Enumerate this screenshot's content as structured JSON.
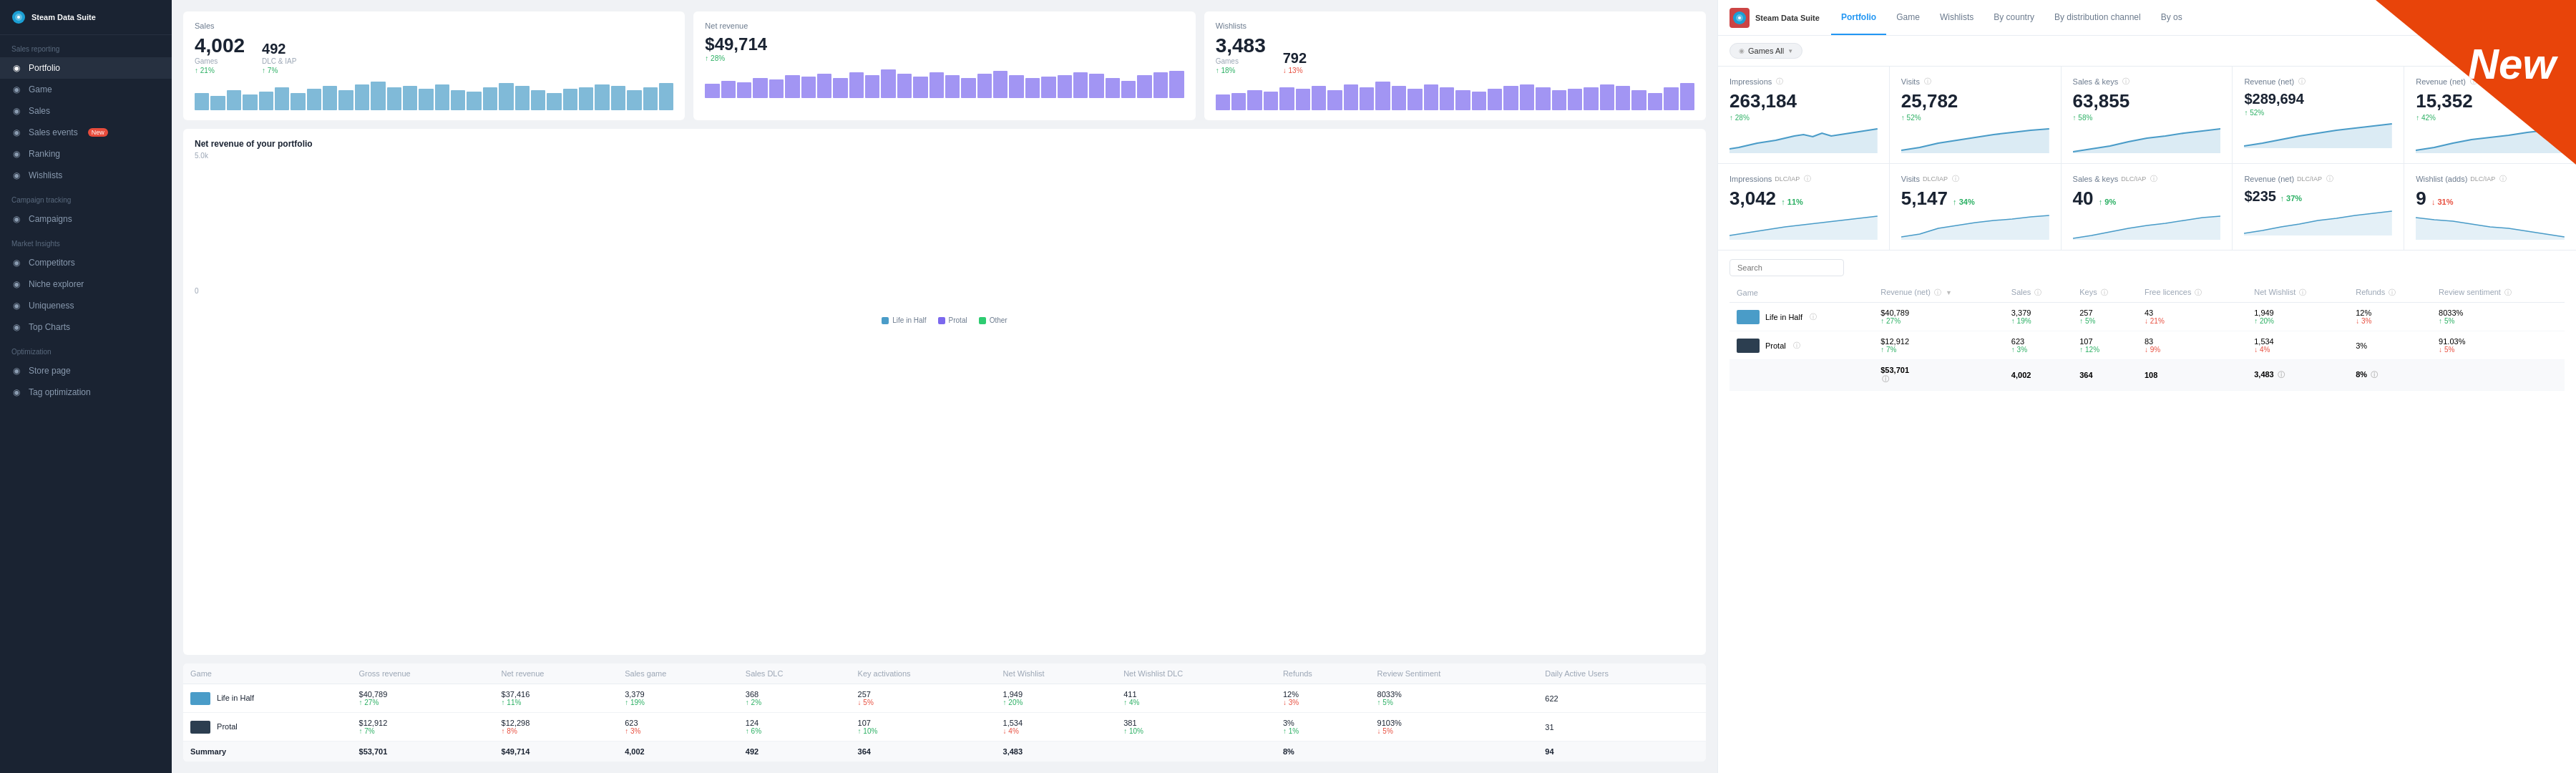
{
  "sidebar": {
    "logo": "Steam Data Suite",
    "sections": [
      {
        "label": "Sales reporting",
        "items": [
          {
            "id": "portfolio",
            "label": "Portfolio",
            "icon": "◉",
            "active": true
          },
          {
            "id": "game",
            "label": "Game",
            "icon": "◉"
          },
          {
            "id": "sales",
            "label": "Sales",
            "icon": "◉"
          },
          {
            "id": "sales-events",
            "label": "Sales events",
            "icon": "◉",
            "badge": "New"
          },
          {
            "id": "ranking",
            "label": "Ranking",
            "icon": "◉"
          },
          {
            "id": "wishlists",
            "label": "Wishlists",
            "icon": "◉"
          }
        ]
      },
      {
        "label": "Campaign tracking",
        "items": [
          {
            "id": "campaigns",
            "label": "Campaigns",
            "icon": "◉"
          }
        ]
      },
      {
        "label": "Market Insights",
        "items": [
          {
            "id": "competitors",
            "label": "Competitors",
            "icon": "◉"
          },
          {
            "id": "niche-explorer",
            "label": "Niche explorer",
            "icon": "◉"
          },
          {
            "id": "uniqueness",
            "label": "Uniqueness",
            "icon": "◉"
          },
          {
            "id": "top-charts",
            "label": "Top Charts",
            "icon": "◉"
          }
        ]
      },
      {
        "label": "Optimization",
        "items": [
          {
            "id": "store-page",
            "label": "Store page",
            "icon": "◉"
          },
          {
            "id": "tag-optimization",
            "label": "Tag optimization",
            "icon": "◉"
          }
        ]
      }
    ]
  },
  "top_cards": [
    {
      "title": "Sales",
      "metrics": [
        {
          "value": "4,002",
          "label": "Games",
          "change": "↑ 21%",
          "up": true
        },
        {
          "value": "492",
          "label": "DLC & IAP",
          "change": "↑ 7%",
          "up": true
        }
      ]
    },
    {
      "title": "Net revenue",
      "metrics": [
        {
          "value": "$49,714",
          "label": "",
          "change": "↑ 28%",
          "up": true
        }
      ]
    },
    {
      "title": "Wishlists",
      "metrics": [
        {
          "value": "3,483",
          "label": "Games",
          "change": "↑ 18%",
          "up": true
        },
        {
          "value": "792",
          "label": "",
          "change": "↓ 13%",
          "up": false
        }
      ]
    }
  ],
  "net_revenue_chart": {
    "title": "Net revenue of your portfolio",
    "y_label": "5.0k",
    "y_label_bottom": "0",
    "legend": [
      {
        "label": "Life in Half",
        "color": "#4a9cc8"
      },
      {
        "label": "Protal",
        "color": "#7b68ee"
      },
      {
        "label": "Other",
        "color": "#2ecc71"
      }
    ]
  },
  "table": {
    "columns": [
      "Game",
      "Gross revenue",
      "Net revenue",
      "Sales game",
      "Sales DLC",
      "Key activations",
      "Net Wishlist",
      "Net Wishlist DLC",
      "Refunds",
      "Review Sentiment",
      "Daily Active Users"
    ],
    "rows": [
      {
        "game": "Life in Half",
        "thumb_color": "#4a9cc8",
        "gross_revenue": "$40,789",
        "gross_change": "↑ 27%",
        "net_revenue": "$37,416",
        "net_change": "↑ 11%",
        "sales_game": "3,379",
        "sales_game_change": "↑ 19%",
        "sales_dlc": "368",
        "sales_dlc_change": "↑ 2%",
        "key_act": "257",
        "key_change": "↓ 5%",
        "net_wish": "1,949",
        "net_wish_change": "↑ 20%",
        "net_wish_dlc": "411",
        "net_wish_dlc_change": "↑ 4%",
        "refunds": "12%",
        "refunds_change": "↓ 3%",
        "sentiment": "8033%",
        "sentiment_change": "↑ 5%",
        "dau": "622"
      },
      {
        "game": "Protal",
        "thumb_color": "#2c3e50",
        "gross_revenue": "$12,912",
        "gross_change": "↑ 7%",
        "net_revenue": "$12,298",
        "net_change": "↑ 8%",
        "sales_game": "623",
        "sales_game_change": "↑ 3%",
        "sales_dlc": "124",
        "sales_dlc_change": "↑ 6%",
        "key_act": "107",
        "key_change": "↑ 10%",
        "net_wish": "1,534",
        "net_wish_change": "↓ 4%",
        "net_wish_dlc": "381",
        "net_wish_dlc_change": "↑ 10%",
        "refunds": "3%",
        "refunds_change": "↑ 1%",
        "sentiment": "9103%",
        "sentiment_change": "↓ 5%",
        "dau": "31"
      }
    ],
    "summary": {
      "label": "Summary",
      "gross": "$53,701",
      "net": "$49,714",
      "sales_game": "4,002",
      "sales_dlc": "492",
      "key_act": "364",
      "net_wish": "3,483",
      "net_wish_dlc": "",
      "refunds": "8%",
      "sentiment": ""
    }
  },
  "right_panel": {
    "logo": "Steam Data Suite",
    "nav_items": [
      {
        "label": "Portfolio",
        "active": true
      },
      {
        "label": "Game",
        "active": false
      },
      {
        "label": "Wishlists",
        "active": false
      },
      {
        "label": "By country",
        "active": false
      },
      {
        "label": "By distribution channel",
        "active": false
      },
      {
        "label": "By os",
        "active": false
      }
    ],
    "new_banner": "New",
    "filter": "Games All",
    "metrics_row1": [
      {
        "label": "Impressions",
        "value": "263,184",
        "change": "↑ 28%",
        "up": true
      },
      {
        "label": "Visits",
        "value": "25,782",
        "change": "↑ 52%",
        "up": true
      },
      {
        "label": "Sales & keys",
        "value": "63,855",
        "change": "↑ 58%",
        "up": true
      },
      {
        "label": "Revenue (net)",
        "value": "$289,694",
        "change": "↑ 52%",
        "up": true
      },
      {
        "label": "Revenue (net)",
        "value": "15,352",
        "change": "↑ 42%",
        "up": true
      }
    ],
    "metrics_row2": [
      {
        "label": "Impressions DLC/IAP",
        "value": "3,042",
        "change": "↑ 11%",
        "up": true
      },
      {
        "label": "Visits DLC/IAP",
        "value": "5,147",
        "change": "↑ 34%",
        "up": true
      },
      {
        "label": "Sales & keys DLC/IAP",
        "value": "40",
        "change": "↑ 9%",
        "up": true
      },
      {
        "label": "Revenue (net) DLC/IAP",
        "value": "$235",
        "change": "↑ 37%",
        "up": true
      },
      {
        "label": "Wishlist (adds) DLC/IAP",
        "value": "9",
        "change": "↓ 31%",
        "up": false
      }
    ],
    "table_columns": [
      "Game",
      "Revenue (net)",
      "Sales",
      "Keys",
      "Free licences",
      "Net Wishlist",
      "Refunds",
      "Review sentiment"
    ],
    "table_rows": [
      {
        "game": "Life in Half",
        "revenue": "$40,789",
        "revenue_change": "↑ 27%",
        "sales": "3,379",
        "sales_change": "↑ 19%",
        "keys": "257",
        "keys_change": "↑ 5%",
        "free": "43",
        "free_change": "↓ 21%",
        "wishlist": "1,949",
        "wish_change": "↑ 20%",
        "refunds": "12%",
        "refunds_change": "↓ 3%",
        "sentiment": "8033%",
        "sent_change": "↑ 5%"
      },
      {
        "game": "Protal",
        "revenue": "$12,912",
        "revenue_change": "↑ 7%",
        "sales": "623",
        "sales_change": "↑ 3%",
        "keys": "107",
        "keys_change": "↑ 12%",
        "free": "83",
        "free_change": "↓ 9%",
        "wishlist": "1,534",
        "wish_change": "↓ 4%",
        "refunds": "3%",
        "refunds_change": "",
        "sentiment": "91.03%",
        "sent_change": "↓ 5%"
      }
    ],
    "table_summary": {
      "revenue": "$53,701",
      "sales": "4,002",
      "keys": "364",
      "free": "108",
      "wishlist": "3,483",
      "refunds": "8%",
      "sentiment": ""
    }
  }
}
